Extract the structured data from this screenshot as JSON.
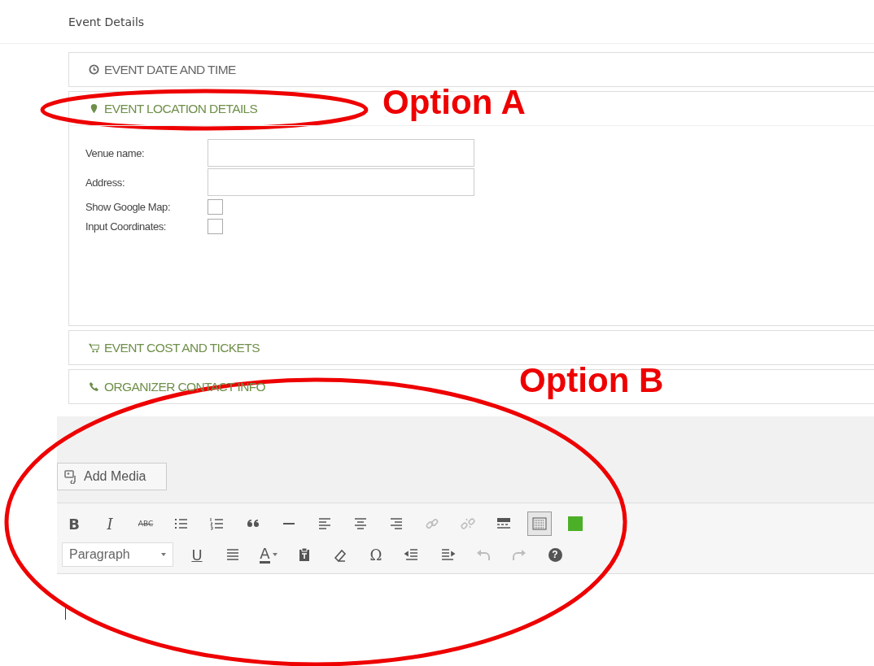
{
  "title": "Event Details",
  "sections": [
    {
      "label": "EVENT DATE AND TIME",
      "expanded": false,
      "color": "#666666"
    },
    {
      "label": "EVENT LOCATION DETAILS",
      "expanded": true,
      "color": "#6f8f4a",
      "fields": [
        {
          "kind": "text",
          "label": "Venue name:"
        },
        {
          "kind": "text",
          "label": "Address:"
        },
        {
          "kind": "checkbox",
          "label": "Show Google Map:",
          "checked": false
        },
        {
          "kind": "checkbox",
          "label": "Input Coordinates:",
          "checked": false
        }
      ]
    },
    {
      "label": "EVENT COST AND TICKETS",
      "expanded": false,
      "color": "#6f8f4a"
    },
    {
      "label": "ORGANIZER CONTACT INFO",
      "expanded": false,
      "color": "#6f8f4a"
    }
  ],
  "add_media": "Add Media",
  "toolbar": {
    "format": "Paragraph",
    "rows": [
      {
        "items": [
          {
            "kind": "bold",
            "label": "B",
            "disabled": false,
            "pressed": false
          },
          {
            "kind": "italic",
            "label": "I",
            "disabled": false,
            "pressed": false
          },
          {
            "kind": "strike",
            "label": "ABC",
            "disabled": false,
            "pressed": false
          },
          {
            "kind": "bullets",
            "disabled": false,
            "pressed": false
          },
          {
            "kind": "numbers",
            "disabled": false,
            "pressed": false
          },
          {
            "kind": "quote",
            "disabled": false,
            "pressed": false
          },
          {
            "kind": "hr",
            "disabled": false,
            "pressed": false
          },
          {
            "kind": "alignleft",
            "disabled": false,
            "pressed": false
          },
          {
            "kind": "aligncenter",
            "disabled": false,
            "pressed": false
          },
          {
            "kind": "alignright",
            "disabled": false,
            "pressed": false
          },
          {
            "kind": "link",
            "disabled": true,
            "pressed": false
          },
          {
            "kind": "unlink",
            "disabled": true,
            "pressed": false
          },
          {
            "kind": "more",
            "disabled": false,
            "pressed": false
          },
          {
            "kind": "toggle",
            "disabled": false,
            "pressed": true
          },
          {
            "kind": "swatch",
            "disabled": false,
            "pressed": false
          }
        ]
      },
      {
        "items": [
          {
            "kind": "underline",
            "label": "U",
            "disabled": false,
            "pressed": false
          },
          {
            "kind": "justify",
            "disabled": false,
            "pressed": false
          },
          {
            "kind": "textcolor",
            "label": "A",
            "disabled": false,
            "pressed": false
          },
          {
            "kind": "paste",
            "disabled": false,
            "pressed": false
          },
          {
            "kind": "eraser",
            "disabled": false,
            "pressed": false
          },
          {
            "kind": "symbol",
            "label": "Ω",
            "disabled": false,
            "pressed": false
          },
          {
            "kind": "outdent",
            "disabled": false,
            "pressed": false
          },
          {
            "kind": "indent",
            "disabled": false,
            "pressed": false
          },
          {
            "kind": "undo",
            "disabled": true,
            "pressed": false
          },
          {
            "kind": "redo",
            "disabled": true,
            "pressed": false
          },
          {
            "kind": "help",
            "label": "?",
            "disabled": false,
            "pressed": false
          }
        ]
      }
    ]
  },
  "annotations": [
    {
      "label": "Option A"
    },
    {
      "label": "Option B"
    }
  ]
}
